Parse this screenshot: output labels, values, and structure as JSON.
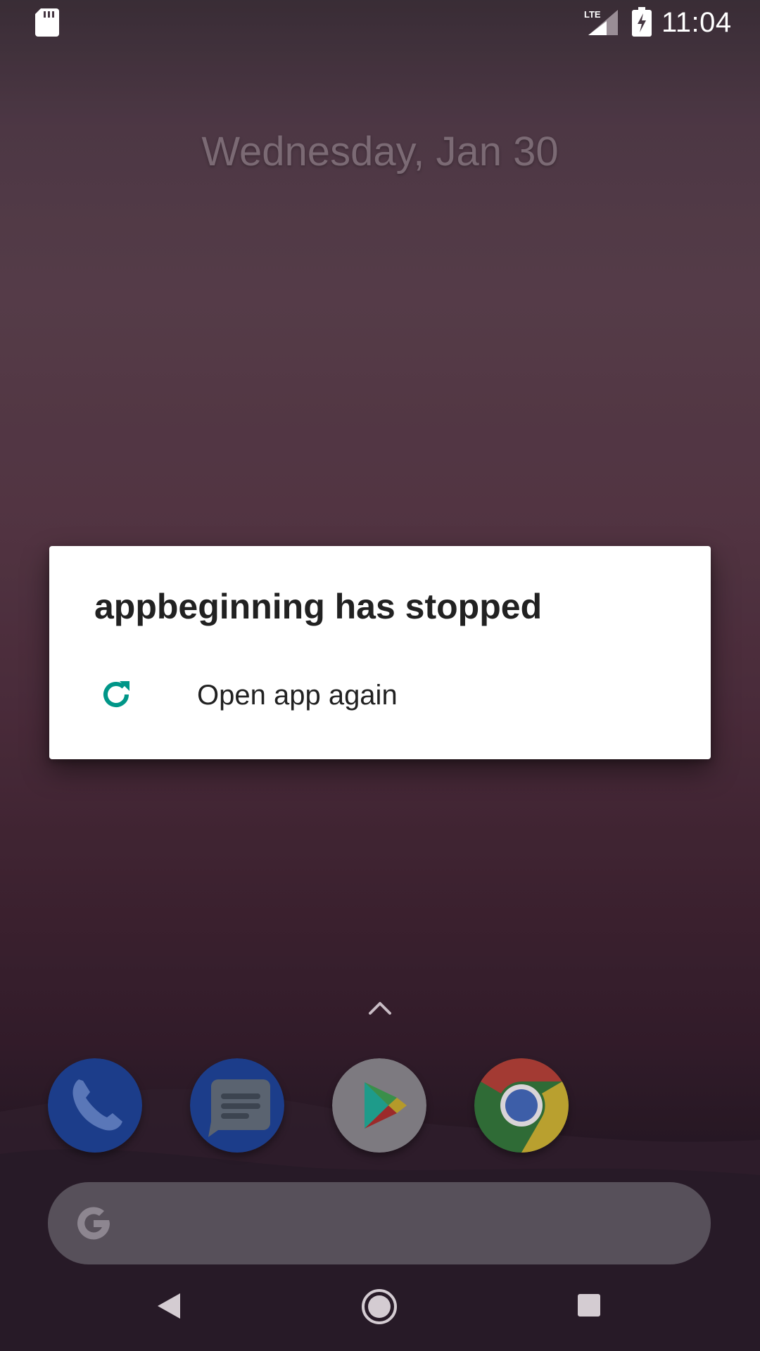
{
  "status_bar": {
    "time": "11:04",
    "network_label": "LTE",
    "icons": [
      "sd-card-icon",
      "lte-signal-icon",
      "battery-charging-icon"
    ]
  },
  "home_screen": {
    "date": "Wednesday, Jan 30"
  },
  "dialog": {
    "title": "appbeginning has stopped",
    "action_label": "Open app again",
    "action_icon": "reload-icon",
    "accent_color": "#009688"
  },
  "dock": {
    "apps": [
      {
        "name": "Phone",
        "icon": "phone-icon"
      },
      {
        "name": "Messages",
        "icon": "messages-icon"
      },
      {
        "name": "Play Store",
        "icon": "play-store-icon"
      },
      {
        "name": "Chrome",
        "icon": "chrome-icon"
      }
    ]
  },
  "search_bar": {
    "icon": "google-g-icon",
    "label": ""
  },
  "nav_bar": {
    "icons": [
      "back-icon",
      "home-icon",
      "recents-icon"
    ]
  }
}
